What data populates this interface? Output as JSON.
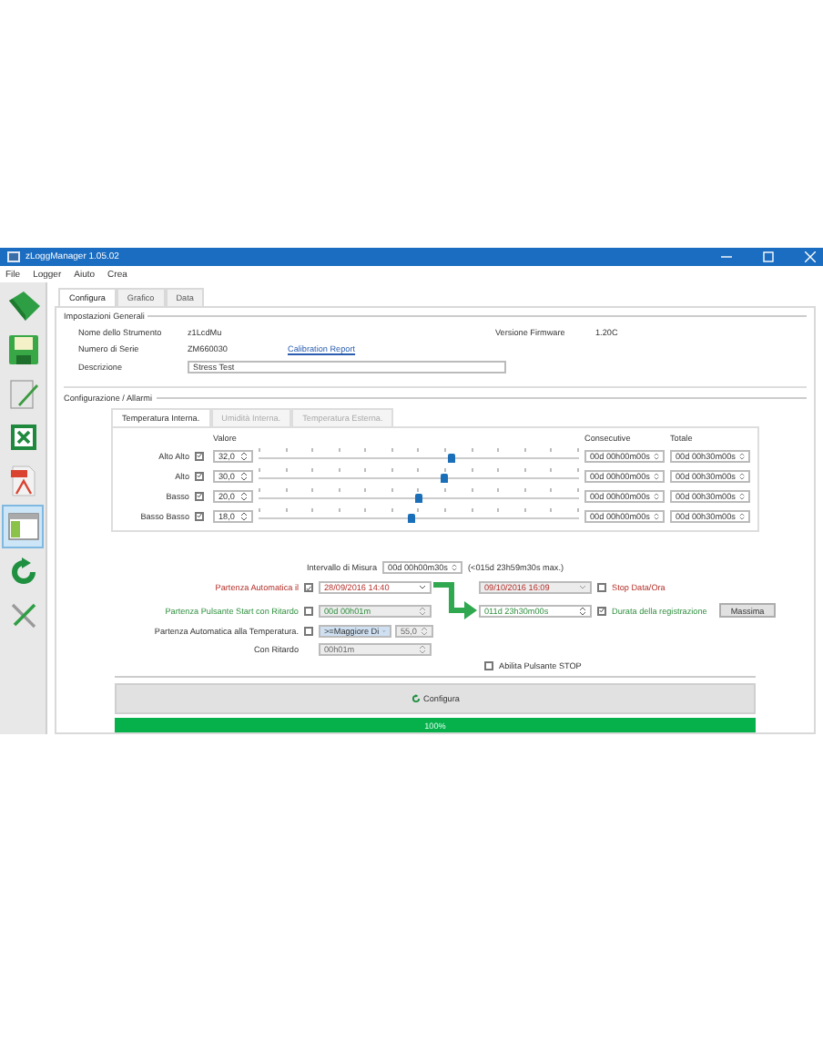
{
  "window": {
    "title": "zLoggManager 1.05.02"
  },
  "menu": [
    "File",
    "Logger",
    "Aiuto",
    "Crea"
  ],
  "toolbar": [
    {
      "kind": "book",
      "selected": false
    },
    {
      "kind": "save",
      "selected": false
    },
    {
      "kind": "edit",
      "selected": false
    },
    {
      "kind": "excel",
      "selected": false
    },
    {
      "kind": "pdf",
      "selected": false
    },
    {
      "kind": "layout",
      "selected": true
    },
    {
      "kind": "refresh",
      "selected": false
    },
    {
      "kind": "tools",
      "selected": false
    }
  ],
  "tabs": [
    {
      "label": "Configura",
      "selected": true
    },
    {
      "label": "Grafico",
      "selected": false
    },
    {
      "label": "Data",
      "selected": false
    }
  ],
  "general": {
    "title": "Impostazioni Generali",
    "name_label": "Nome dello Strumento",
    "name": "z1LcdMu",
    "serial_label": "Numero di Serie",
    "serial": "ZM660030",
    "calibration_link": "Calibration Report",
    "description_label": "Descrizione",
    "description": "Stress Test",
    "firmware_label": "Versione Firmware",
    "firmware": "1.20C"
  },
  "alarms": {
    "title": "Configurazione / Allarmi",
    "tabs": [
      {
        "label": "Temperatura Interna.",
        "selected": true
      },
      {
        "label": "Umidità Interna.",
        "selected": false
      },
      {
        "label": "Temperatura Esterna.",
        "selected": false
      }
    ],
    "value_header": "Valore",
    "consecutive_header": "Consecutive",
    "total_header": "Totale",
    "rows": [
      {
        "label": "Alto Alto",
        "checked": true,
        "value": "32,0",
        "level": 0.6,
        "consecutive": "00d 00h00m00s",
        "total": "00d 00h30m00s"
      },
      {
        "label": "Alto",
        "checked": true,
        "value": "30,0",
        "level": 0.58,
        "consecutive": "00d 00h00m00s",
        "total": "00d 00h30m00s"
      },
      {
        "label": "Basso",
        "checked": true,
        "value": "20,0",
        "level": 0.5,
        "consecutive": "00d 00h00m00s",
        "total": "00d 00h30m00s"
      },
      {
        "label": "Basso Basso",
        "checked": true,
        "value": "18,0",
        "level": 0.48,
        "consecutive": "00d 00h00m00s",
        "total": "00d 00h30m00s"
      }
    ]
  },
  "interval": {
    "label": "Intervallo di Misura",
    "value": "00d 00h00m30s",
    "note": "(<015d 23h59m30s max.)"
  },
  "auto_start": {
    "label": "Partenza Automatica il",
    "checked": true,
    "date": "28/09/2016 14:40"
  },
  "stop_date": {
    "value": "09/10/2016 16:09",
    "checked": false,
    "label": "Stop Data/Ora"
  },
  "button_start": {
    "label": "Partenza Pulsante Start con Ritardo",
    "checked": false,
    "delay": "00d 00h01m"
  },
  "duration": {
    "value": "011d 23h30m00s",
    "checked": true,
    "label": "Durata della registrazione",
    "button": "Massima"
  },
  "temp_start": {
    "label": "Partenza Automatica alla Temperatura.",
    "checked": false,
    "condition": ">=Maggiore Di",
    "value": "55,0"
  },
  "delay": {
    "label": "Con Ritardo",
    "value": "00h01m"
  },
  "stop_button": {
    "label": "Abilita Pulsante STOP",
    "checked": false
  },
  "configure_button": "Configura",
  "progress": {
    "level": 1,
    "text": "100%"
  }
}
